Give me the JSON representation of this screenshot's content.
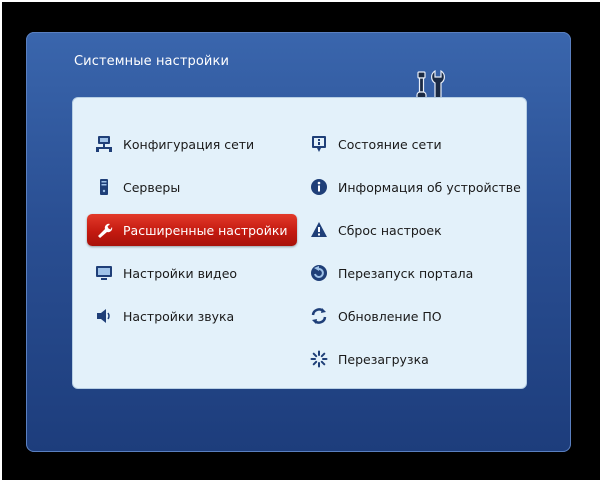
{
  "window": {
    "title": "Системные настройки"
  },
  "menu": {
    "left": [
      {
        "label": "Конфигурация сети",
        "icon": "network-config-icon"
      },
      {
        "label": "Серверы",
        "icon": "server-icon"
      },
      {
        "label": "Расширенные настройки",
        "icon": "wrench-icon",
        "selected": true
      },
      {
        "label": "Настройки видео",
        "icon": "monitor-icon"
      },
      {
        "label": "Настройки звука",
        "icon": "speaker-icon"
      }
    ],
    "right": [
      {
        "label": "Состояние сети",
        "icon": "network-status-icon"
      },
      {
        "label": "Информация об устройстве",
        "icon": "info-icon"
      },
      {
        "label": "Сброс настроек",
        "icon": "warning-icon"
      },
      {
        "label": "Перезапуск портала",
        "icon": "restart-portal-icon"
      },
      {
        "label": "Обновление ПО",
        "icon": "update-icon"
      },
      {
        "label": "Перезагрузка",
        "icon": "reboot-icon"
      }
    ]
  },
  "colors": {
    "panel": "#2a4f93",
    "menu_background": "#e3f1fa",
    "selected": "#c41a10",
    "icon": "#1f3f78"
  }
}
